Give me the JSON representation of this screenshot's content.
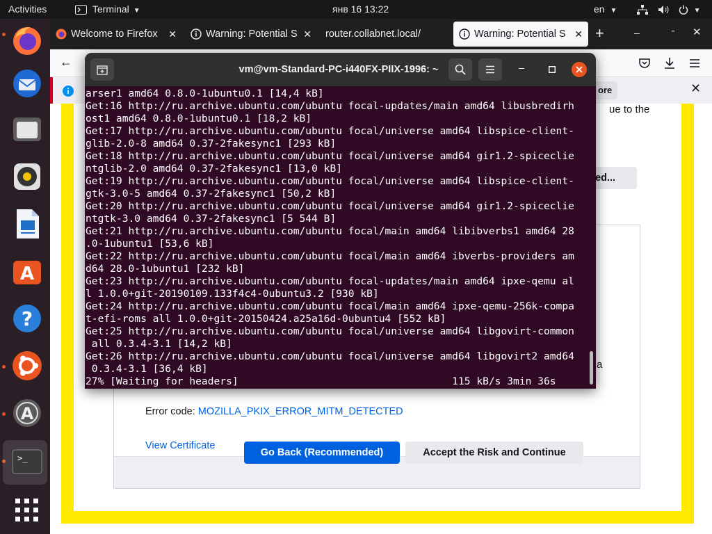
{
  "topbar": {
    "activities": "Activities",
    "app_name": "Terminal",
    "datetime": "янв 16  13:22",
    "language": "en"
  },
  "dock": {
    "items": [
      "Firefox",
      "Thunderbird",
      "Files",
      "Rhythmbox",
      "LibreOffice Writer",
      "Ubuntu Software",
      "Help",
      "Ubuntu",
      "Software Updater",
      "Terminal",
      "Show Applications"
    ]
  },
  "firefox": {
    "tabs": [
      {
        "label": "Welcome to Firefox"
      },
      {
        "label": "Warning: Potential S"
      },
      {
        "label": "router.collabnet.local/"
      },
      {
        "label": "Warning: Potential S"
      }
    ],
    "notice_right": "ore",
    "page": {
      "partial_text": "ue to the",
      "advanced_button": "ced...",
      "partial_a": "a",
      "error_code_label": "Error code: ",
      "error_code": "MOZILLA_PKIX_ERROR_MITM_DETECTED",
      "view_certificate": "View Certificate",
      "go_back": "Go Back (Recommended)",
      "accept": "Accept the Risk and Continue"
    }
  },
  "terminal": {
    "title": "vm@vm-Standard-PC-i440FX-PIIX-1996: ~",
    "lines": [
      "arser1 amd64 0.8.0-1ubuntu0.1 [14,4 kB]",
      "Get:16 http://ru.archive.ubuntu.com/ubuntu focal-updates/main amd64 libusbredirh",
      "ost1 amd64 0.8.0-1ubuntu0.1 [18,2 kB]",
      "Get:17 http://ru.archive.ubuntu.com/ubuntu focal/universe amd64 libspice-client-",
      "glib-2.0-8 amd64 0.37-2fakesync1 [293 kB]",
      "Get:18 http://ru.archive.ubuntu.com/ubuntu focal/universe amd64 gir1.2-spiceclie",
      "ntglib-2.0 amd64 0.37-2fakesync1 [13,0 kB]",
      "Get:19 http://ru.archive.ubuntu.com/ubuntu focal/universe amd64 libspice-client-",
      "gtk-3.0-5 amd64 0.37-2fakesync1 [50,2 kB]",
      "Get:20 http://ru.archive.ubuntu.com/ubuntu focal/universe amd64 gir1.2-spiceclie",
      "ntgtk-3.0 amd64 0.37-2fakesync1 [5 544 B]",
      "Get:21 http://ru.archive.ubuntu.com/ubuntu focal/main amd64 libibverbs1 amd64 28",
      ".0-1ubuntu1 [53,6 kB]",
      "Get:22 http://ru.archive.ubuntu.com/ubuntu focal/main amd64 ibverbs-providers am",
      "d64 28.0-1ubuntu1 [232 kB]",
      "Get:23 http://ru.archive.ubuntu.com/ubuntu focal-updates/main amd64 ipxe-qemu al",
      "l 1.0.0+git-20190109.133f4c4-0ubuntu3.2 [930 kB]",
      "Get:24 http://ru.archive.ubuntu.com/ubuntu focal/main amd64 ipxe-qemu-256k-compa",
      "t-efi-roms all 1.0.0+git-20150424.a25a16d-0ubuntu4 [552 kB]",
      "Get:25 http://ru.archive.ubuntu.com/ubuntu focal/universe amd64 libgovirt-common",
      " all 0.3.4-3.1 [14,2 kB]",
      "Get:26 http://ru.archive.ubuntu.com/ubuntu focal/universe amd64 libgovirt2 amd64",
      " 0.3.4-3.1 [36,4 kB]",
      "27% [Waiting for headers]                                   115 kB/s 3min 36s"
    ]
  }
}
